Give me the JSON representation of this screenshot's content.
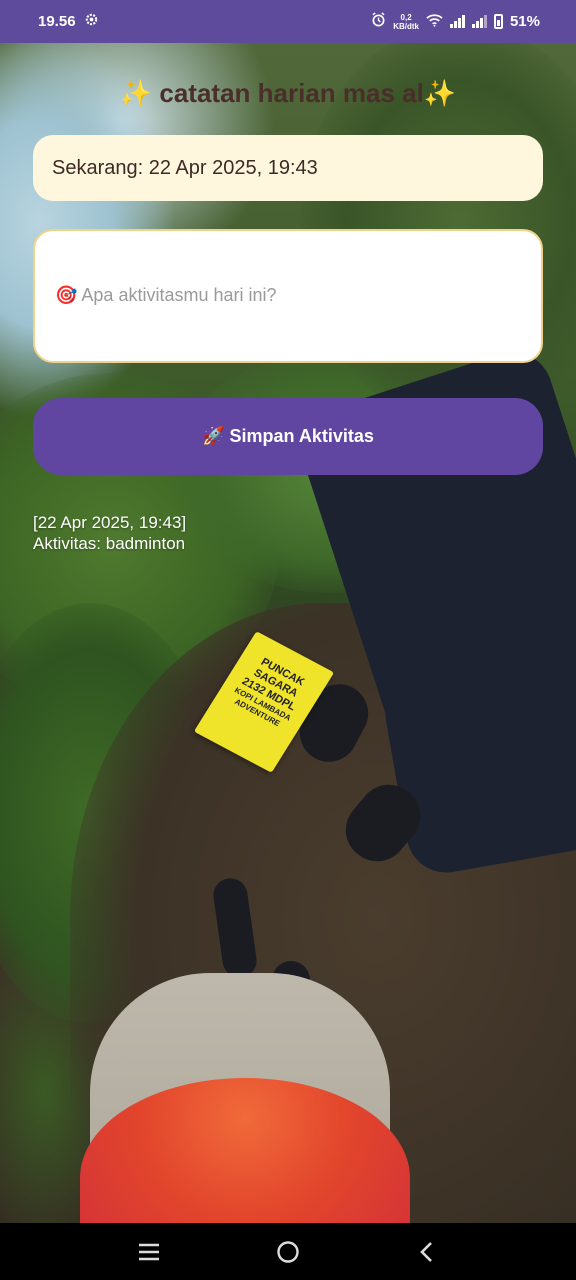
{
  "status_bar": {
    "time": "19.56",
    "net_speed_value": "0,2",
    "net_speed_unit": "KB/dtk",
    "battery": "51%",
    "icons": [
      "settings-icon",
      "alarm-icon",
      "wifi-icon",
      "signal-icon",
      "signal-icon",
      "battery-icon"
    ]
  },
  "app": {
    "title": "✨ catatan harian mas al✨",
    "current_time_label": "Sekarang: 22 Apr 2025, 19:43",
    "activity_input": {
      "value": "",
      "placeholder": "🎯 Apa aktivitasmu hari ini?"
    },
    "save_button_label": "🚀 Simpan Aktivitas",
    "log_entry": {
      "timestamp": "[22 Apr 2025, 19:43]",
      "activity": "Aktivitas: badminton"
    }
  },
  "background_sign": {
    "lines": [
      "PUNCAK",
      "SAGARA",
      "2132 MDPL",
      "KOPI LAMBADA",
      "ADVENTURE"
    ]
  },
  "nav_bar": {
    "buttons": [
      "recents-icon",
      "home-icon",
      "back-icon"
    ]
  },
  "colors": {
    "status_bar": "#5f4b9c",
    "primary_button": "#6146a1",
    "date_box": "#fef6dd",
    "input_border": "#f0d28a"
  }
}
